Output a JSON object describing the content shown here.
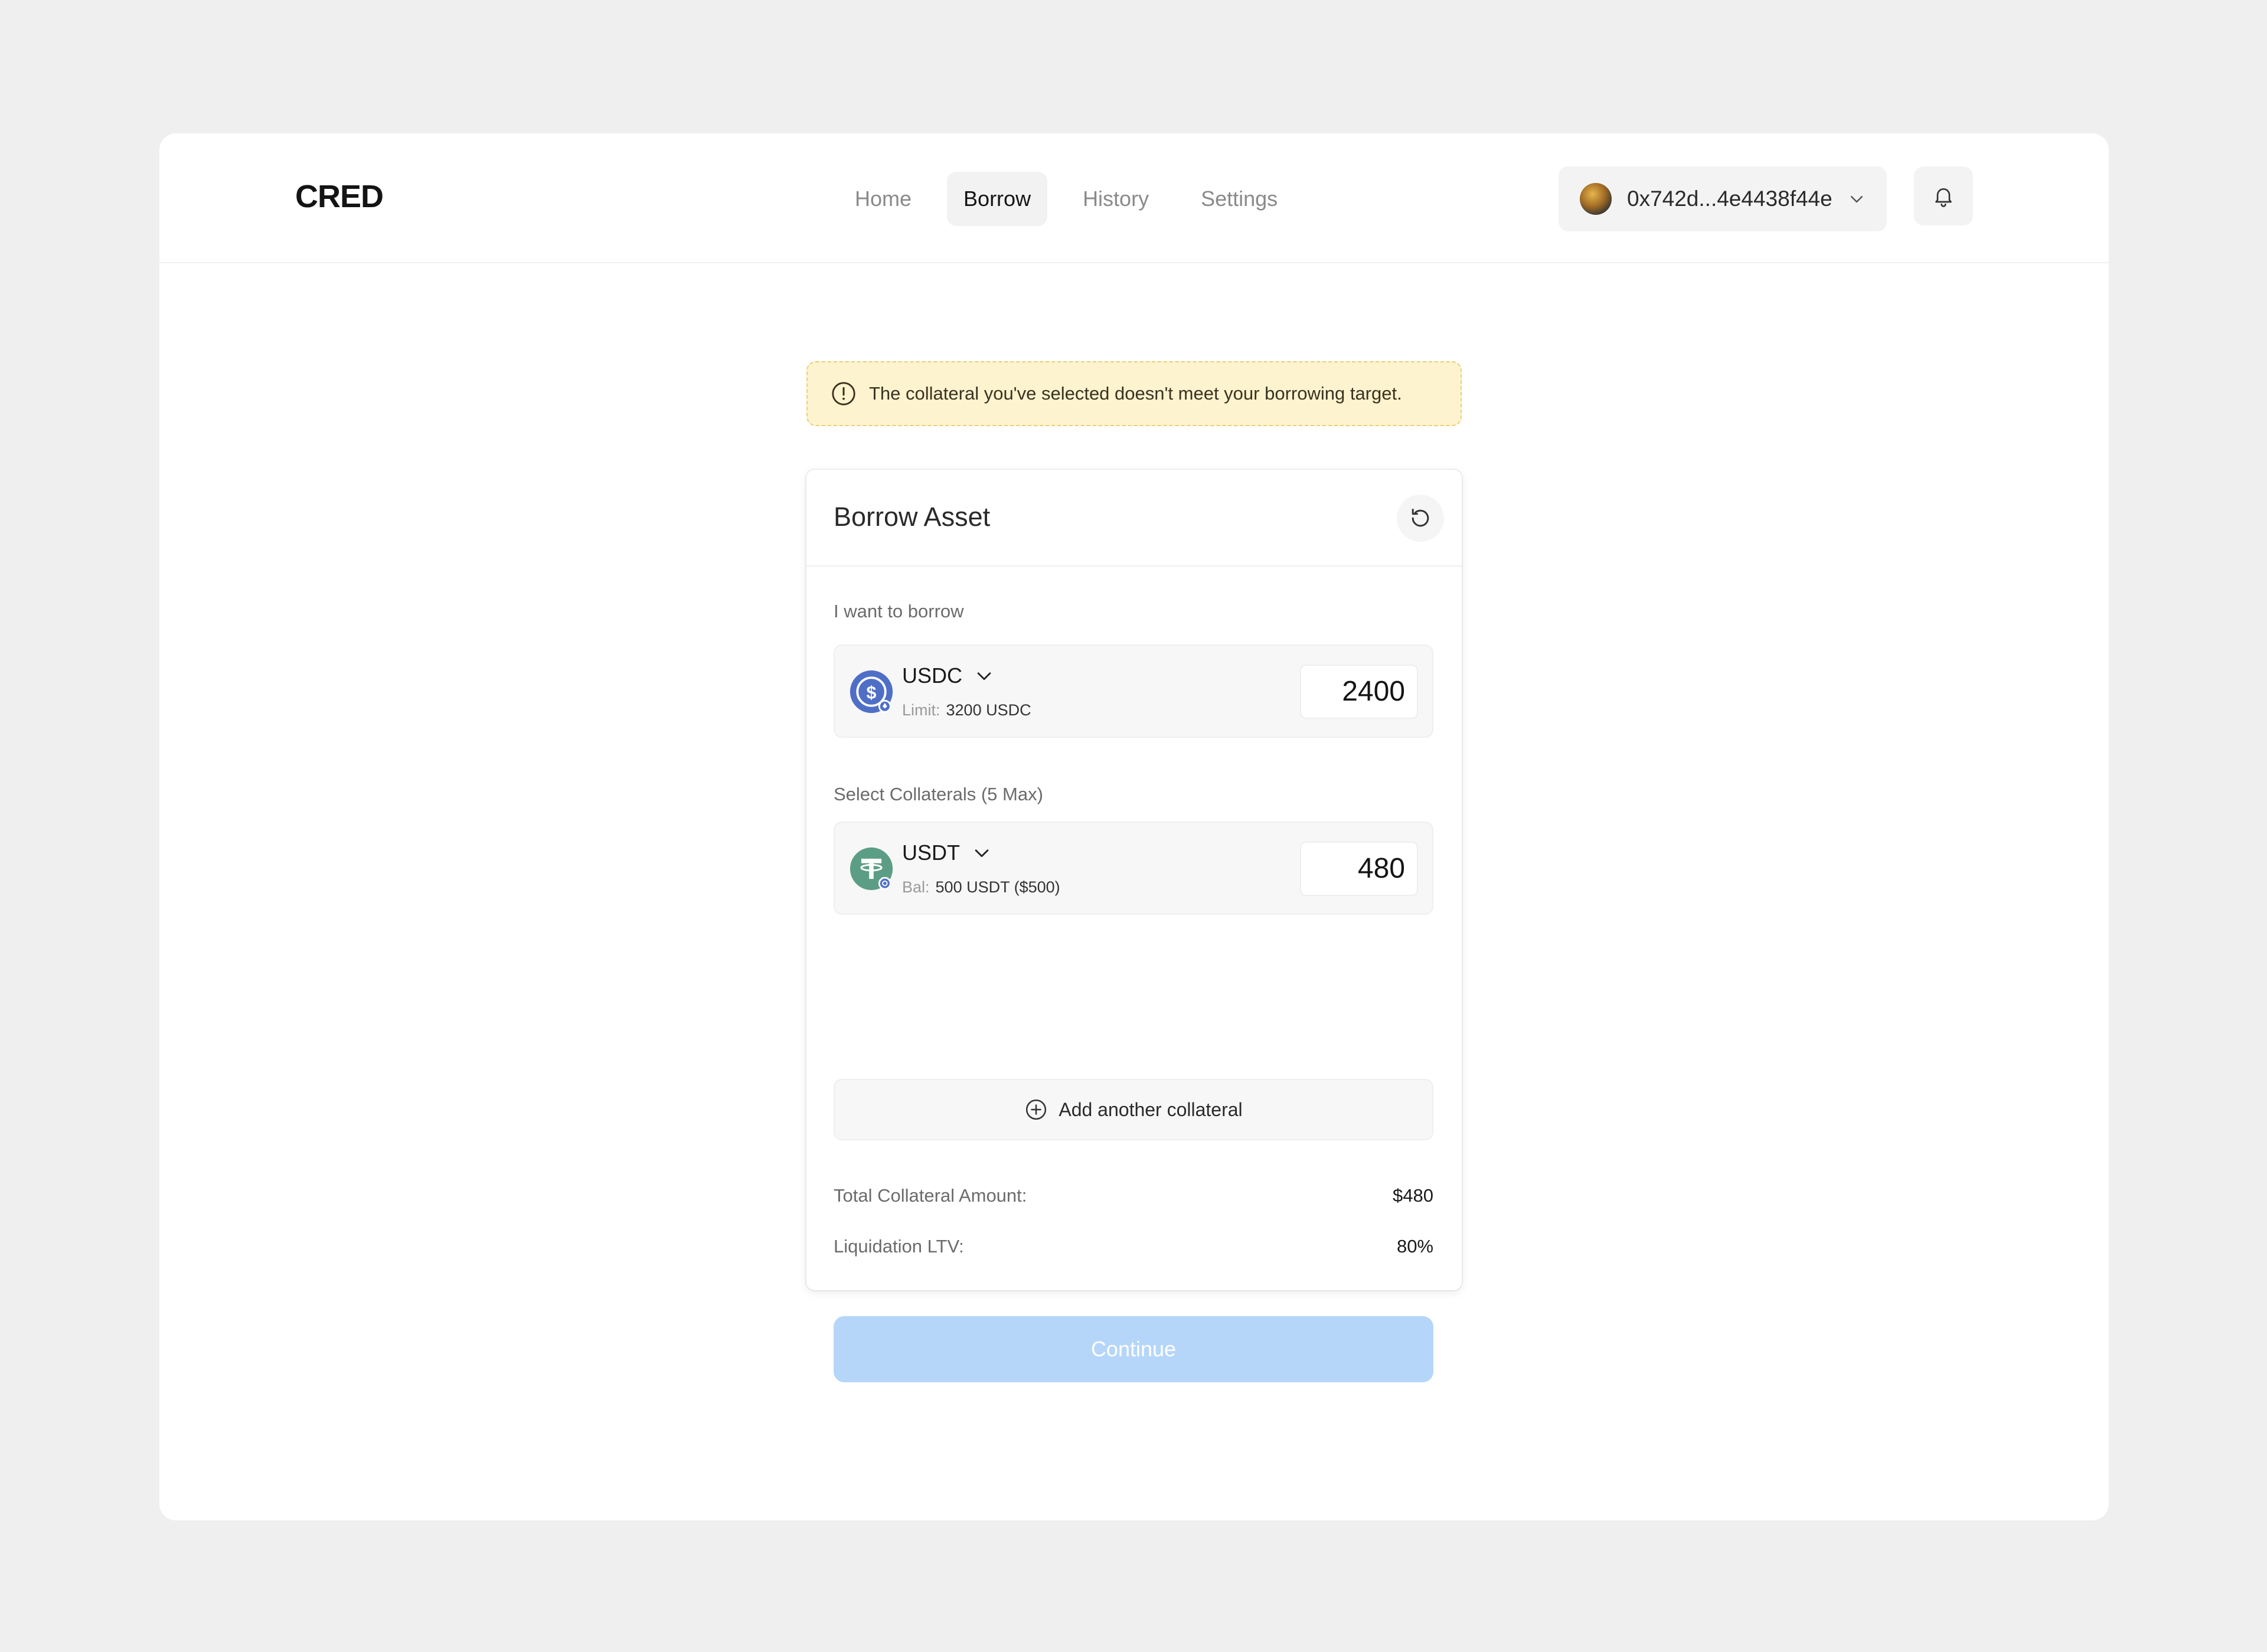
{
  "brand": {
    "logo": "CRED"
  },
  "nav": {
    "items": [
      {
        "label": "Home",
        "active": false
      },
      {
        "label": "Borrow",
        "active": true
      },
      {
        "label": "History",
        "active": false
      },
      {
        "label": "Settings",
        "active": false
      }
    ]
  },
  "wallet": {
    "address": "0x742d...4e4438f44e",
    "icon": "avatar-image"
  },
  "notifications": {
    "icon": "bell-icon"
  },
  "alert": {
    "icon": "warning-circle-icon",
    "text": "The collateral you've selected doesn't meet your borrowing target."
  },
  "card": {
    "title": "Borrow Asset",
    "refresh_icon": "refresh-icon",
    "borrow": {
      "label": "I want to borrow",
      "asset": "USDC",
      "sub_label": "Limit:",
      "sub_value": "3200 USDC",
      "amount": "2400"
    },
    "collaterals": {
      "label": "Select Collaterals (5 Max)",
      "items": [
        {
          "asset": "USDT",
          "sub_label": "Bal:",
          "sub_value": "500 USDT ($500)",
          "amount": "480"
        }
      ],
      "add_label": "Add another collateral"
    },
    "summary": {
      "total_label": "Total Collateral Amount:",
      "total_value": "$480",
      "ltv_label": "Liquidation LTV:",
      "ltv_value": "80%"
    },
    "continue_label": "Continue"
  },
  "colors": {
    "accent_disabled": "#b5d6f8",
    "alert_bg": "#fdf3cf",
    "usdc": "#4f6fc7",
    "usdt": "#5c9e85"
  }
}
